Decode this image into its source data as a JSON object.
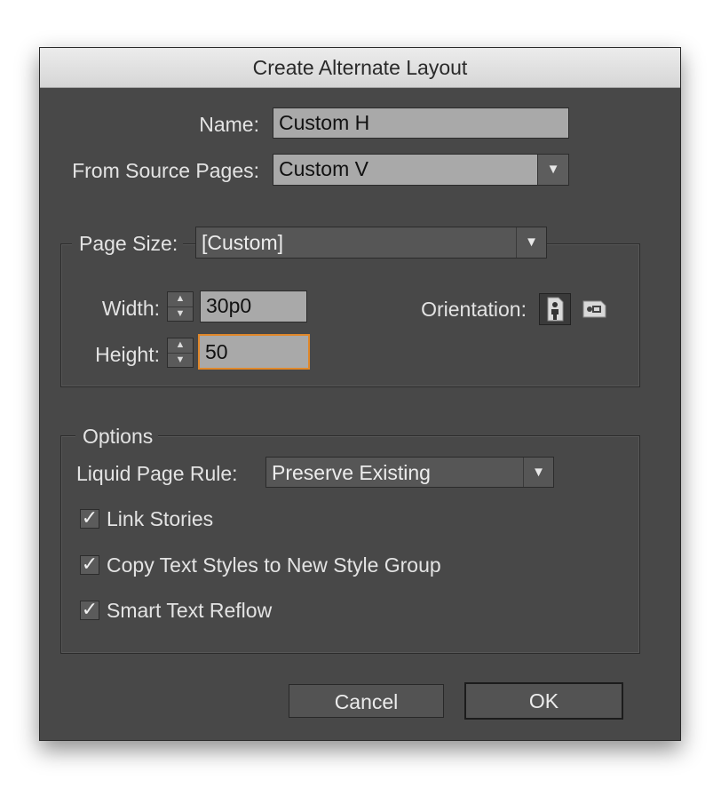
{
  "dialog": {
    "title": "Create Alternate Layout"
  },
  "name": {
    "label": "Name:",
    "value": "Custom H"
  },
  "source": {
    "label": "From Source Pages:",
    "value": "Custom V"
  },
  "page_size": {
    "label": "Page Size:",
    "value": "[Custom]",
    "width_label": "Width:",
    "width_value": "30p0",
    "height_label": "Height:",
    "height_value": "50",
    "orientation_label": "Orientation:",
    "orientation_selected": "portrait"
  },
  "options": {
    "legend": "Options",
    "liquid_label": "Liquid Page Rule:",
    "liquid_value": "Preserve Existing",
    "link_stories": "Link Stories",
    "copy_styles": "Copy Text Styles to New Style Group",
    "smart_reflow": "Smart Text Reflow",
    "link_stories_checked": true,
    "copy_styles_checked": true,
    "smart_reflow_checked": true
  },
  "buttons": {
    "cancel": "Cancel",
    "ok": "OK"
  },
  "colors": {
    "dialog_bg": "#484848",
    "field_bg": "#a9a9a9",
    "focus": "#e0882b"
  }
}
